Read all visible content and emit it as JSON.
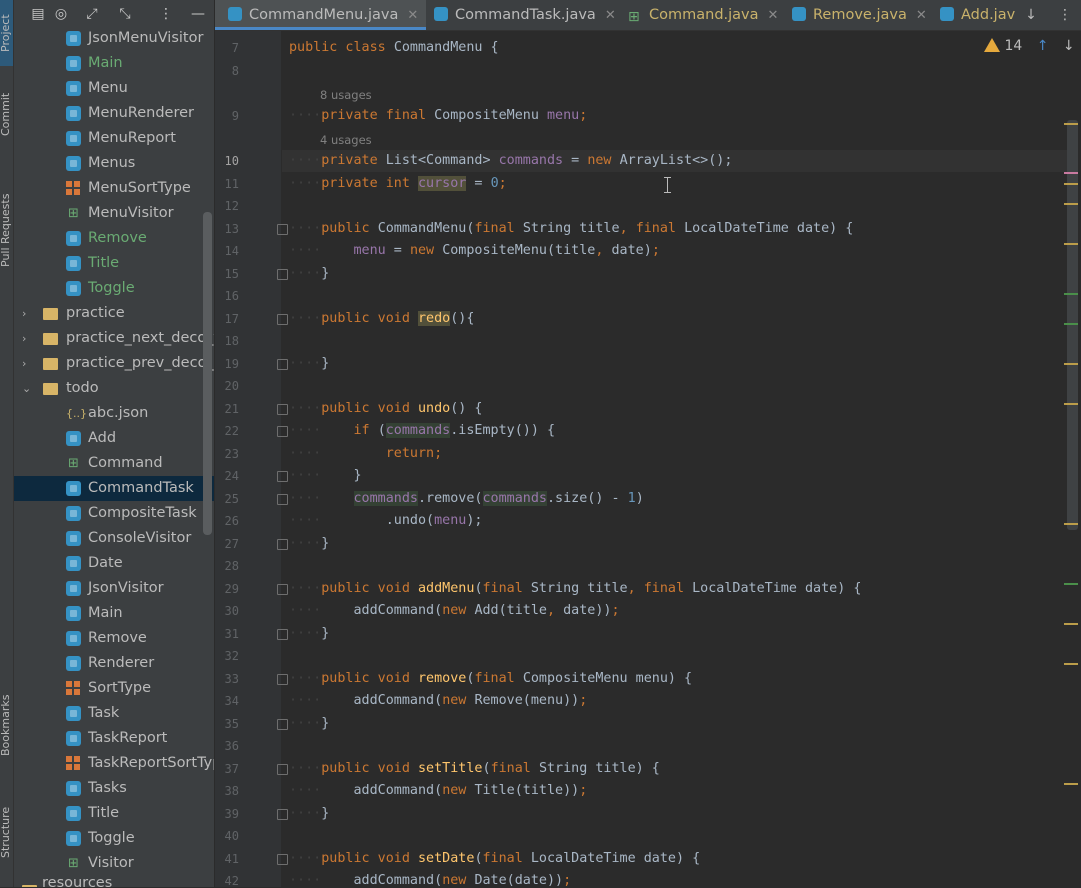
{
  "stripe": {
    "tabs": [
      "Project",
      "Commit",
      "Pull Requests",
      "Bookmarks",
      "Structure"
    ]
  },
  "tree": [
    {
      "label": "JsonMenuVisitor",
      "icon": "class-icon"
    },
    {
      "label": "Main",
      "icon": "class-run-icon",
      "color": "#6aab73"
    },
    {
      "label": "Menu",
      "icon": "class-icon"
    },
    {
      "label": "MenuRenderer",
      "icon": "class-icon"
    },
    {
      "label": "MenuReport",
      "icon": "class-icon"
    },
    {
      "label": "Menus",
      "icon": "class-icon"
    },
    {
      "label": "MenuSortType",
      "icon": "enum-icon"
    },
    {
      "label": "MenuVisitor",
      "icon": "interface-icon"
    },
    {
      "label": "Remove",
      "icon": "class-icon",
      "color": "#6aab73"
    },
    {
      "label": "Title",
      "icon": "class-icon",
      "color": "#6aab73"
    },
    {
      "label": "Toggle",
      "icon": "class-icon",
      "color": "#6aab73"
    },
    {
      "label": "practice",
      "icon": "folder-icon",
      "caret": "›"
    },
    {
      "label": "practice_next_deco_fo",
      "icon": "folder-icon",
      "caret": "›"
    },
    {
      "label": "practice_prev_deco_fo",
      "icon": "folder-icon",
      "caret": "›"
    },
    {
      "label": "todo",
      "icon": "folder-icon",
      "caret": "⌄"
    },
    {
      "label": "abc.json",
      "icon": "json-icon"
    },
    {
      "label": "Add",
      "icon": "class-icon"
    },
    {
      "label": "Command",
      "icon": "interface-icon"
    },
    {
      "label": "CommandTask",
      "icon": "class-icon",
      "selected": true
    },
    {
      "label": "CompositeTask",
      "icon": "class-icon"
    },
    {
      "label": "ConsoleVisitor",
      "icon": "class-icon"
    },
    {
      "label": "Date",
      "icon": "class-icon"
    },
    {
      "label": "JsonVisitor",
      "icon": "class-icon"
    },
    {
      "label": "Main",
      "icon": "class-run-icon"
    },
    {
      "label": "Remove",
      "icon": "class-icon"
    },
    {
      "label": "Renderer",
      "icon": "class-icon"
    },
    {
      "label": "SortType",
      "icon": "enum-icon"
    },
    {
      "label": "Task",
      "icon": "class-icon"
    },
    {
      "label": "TaskReport",
      "icon": "class-icon"
    },
    {
      "label": "TaskReportSortTyp",
      "icon": "enum-icon"
    },
    {
      "label": "Tasks",
      "icon": "class-icon"
    },
    {
      "label": "Title",
      "icon": "class-icon"
    },
    {
      "label": "Toggle",
      "icon": "class-icon"
    },
    {
      "label": "Visitor",
      "icon": "interface-icon"
    }
  ],
  "tree_partial_label": "resources",
  "tabs": [
    {
      "label": "CommandMenu.java",
      "icon": "class-icon",
      "active": true,
      "color": "#bbbbbb"
    },
    {
      "label": "CommandTask.java",
      "icon": "class-icon",
      "color": "#bbbbbb"
    },
    {
      "label": "Command.java",
      "icon": "interface-icon",
      "color": "#c9b26b"
    },
    {
      "label": "Remove.java",
      "icon": "class-icon",
      "color": "#c9b26b"
    },
    {
      "label": "Add.jav",
      "icon": "class-icon",
      "color": "#c9b26b"
    }
  ],
  "warnings": {
    "count": "14"
  },
  "hints": {
    "menu_usages": "8 usages",
    "commands_usages": "4 usages"
  },
  "line_numbers": [
    "7",
    "8",
    "9",
    "10",
    "11",
    "12",
    "13",
    "14",
    "15",
    "16",
    "17",
    "18",
    "19",
    "20",
    "21",
    "22",
    "23",
    "24",
    "25",
    "26",
    "27",
    "28",
    "29",
    "30",
    "31",
    "32",
    "33",
    "34",
    "35",
    "36",
    "37",
    "38",
    "39",
    "40",
    "41",
    "42"
  ],
  "current_line": "10",
  "colors": {
    "keyword": "#cc7832",
    "field": "#9876aa",
    "number": "#6897bb",
    "method": "#ffc66d",
    "text": "#a9b7c6",
    "selection": "#0d293e",
    "accent": "#4a88c7"
  },
  "code": [
    [
      [
        "public class ",
        "kw"
      ],
      [
        "CommandMenu {",
        ""
      ]
    ],
    [],
    [
      [
        "private final ",
        "kw"
      ],
      [
        "CompositeMenu ",
        ""
      ],
      [
        "menu",
        "fld"
      ],
      [
        ";",
        "kw"
      ]
    ],
    [
      [
        "private ",
        "kw"
      ],
      [
        "List<Command> ",
        ""
      ],
      [
        "commands",
        "fld"
      ],
      [
        " = ",
        ""
      ],
      [
        "new ",
        "kw"
      ],
      [
        "ArrayList<>();",
        ""
      ]
    ],
    [
      [
        "private int ",
        "kw"
      ],
      [
        "cursor",
        "fld hl2"
      ],
      [
        " = ",
        ""
      ],
      [
        "0",
        "num"
      ],
      [
        ";",
        "kw"
      ]
    ],
    [],
    [
      [
        "public ",
        "kw"
      ],
      [
        "CommandMenu(",
        ""
      ],
      [
        "final ",
        "kw"
      ],
      [
        "String title",
        ""
      ],
      [
        ", ",
        "kw"
      ],
      [
        "final ",
        "kw"
      ],
      [
        "LocalDateTime date) {",
        ""
      ]
    ],
    [
      [
        "    menu",
        "fld"
      ],
      [
        " = ",
        ""
      ],
      [
        "new ",
        "kw"
      ],
      [
        "CompositeMenu(title",
        ""
      ],
      [
        ", ",
        "kw"
      ],
      [
        "date)",
        ""
      ],
      [
        ";",
        "kw"
      ]
    ],
    [
      [
        "}",
        ""
      ]
    ],
    [],
    [
      [
        "public void ",
        "kw"
      ],
      [
        "redo",
        "mth hl2"
      ],
      [
        "(){",
        ""
      ]
    ],
    [],
    [
      [
        "}",
        ""
      ]
    ],
    [],
    [
      [
        "public void ",
        "kw"
      ],
      [
        "undo",
        "mth"
      ],
      [
        "() {",
        ""
      ]
    ],
    [
      [
        "    ",
        ""
      ],
      [
        "if ",
        "kw"
      ],
      [
        "(",
        ""
      ],
      [
        "commands",
        "fld hl"
      ],
      [
        ".isEmpty()) {",
        ""
      ]
    ],
    [
      [
        "        ",
        ""
      ],
      [
        "return",
        "kw"
      ],
      [
        ";",
        "kw"
      ]
    ],
    [
      [
        "    }",
        ""
      ]
    ],
    [
      [
        "    ",
        ""
      ],
      [
        "commands",
        "fld hl"
      ],
      [
        ".remove(",
        ""
      ],
      [
        "commands",
        "fld hl"
      ],
      [
        ".size() - ",
        ""
      ],
      [
        "1",
        "num"
      ],
      [
        ")",
        ""
      ]
    ],
    [
      [
        "        .undo(",
        ""
      ],
      [
        "menu",
        "fld"
      ],
      [
        ");",
        ""
      ]
    ],
    [
      [
        "}",
        ""
      ]
    ],
    [],
    [
      [
        "public void ",
        "kw"
      ],
      [
        "addMenu",
        "mth"
      ],
      [
        "(",
        ""
      ],
      [
        "final ",
        "kw"
      ],
      [
        "String title",
        ""
      ],
      [
        ", ",
        "kw"
      ],
      [
        "final ",
        "kw"
      ],
      [
        "LocalDateTime date) {",
        ""
      ]
    ],
    [
      [
        "    addCommand(",
        ""
      ],
      [
        "new ",
        "kw"
      ],
      [
        "Add(title",
        ""
      ],
      [
        ", ",
        "kw"
      ],
      [
        "date))",
        ""
      ],
      [
        ";",
        "kw"
      ]
    ],
    [
      [
        "}",
        ""
      ]
    ],
    [],
    [
      [
        "public void ",
        "kw"
      ],
      [
        "remove",
        "mth"
      ],
      [
        "(",
        ""
      ],
      [
        "final ",
        "kw"
      ],
      [
        "CompositeMenu menu) {",
        ""
      ]
    ],
    [
      [
        "    addCommand(",
        ""
      ],
      [
        "new ",
        "kw"
      ],
      [
        "Remove(menu))",
        ""
      ],
      [
        ";",
        "kw"
      ]
    ],
    [
      [
        "}",
        ""
      ]
    ],
    [],
    [
      [
        "public void ",
        "kw"
      ],
      [
        "setTitle",
        "mth"
      ],
      [
        "(",
        ""
      ],
      [
        "final ",
        "kw"
      ],
      [
        "String title) {",
        ""
      ]
    ],
    [
      [
        "    addCommand(",
        ""
      ],
      [
        "new ",
        "kw"
      ],
      [
        "Title(title))",
        ""
      ],
      [
        ";",
        "kw"
      ]
    ],
    [
      [
        "}",
        ""
      ]
    ],
    [],
    [
      [
        "public void ",
        "kw"
      ],
      [
        "setDate",
        "mth"
      ],
      [
        "(",
        ""
      ],
      [
        "final ",
        "kw"
      ],
      [
        "LocalDateTime date) {",
        ""
      ]
    ],
    [
      [
        "    addCommand(",
        ""
      ],
      [
        "new ",
        "kw"
      ],
      [
        "Date(date))",
        ""
      ],
      [
        ";",
        "kw"
      ]
    ]
  ]
}
